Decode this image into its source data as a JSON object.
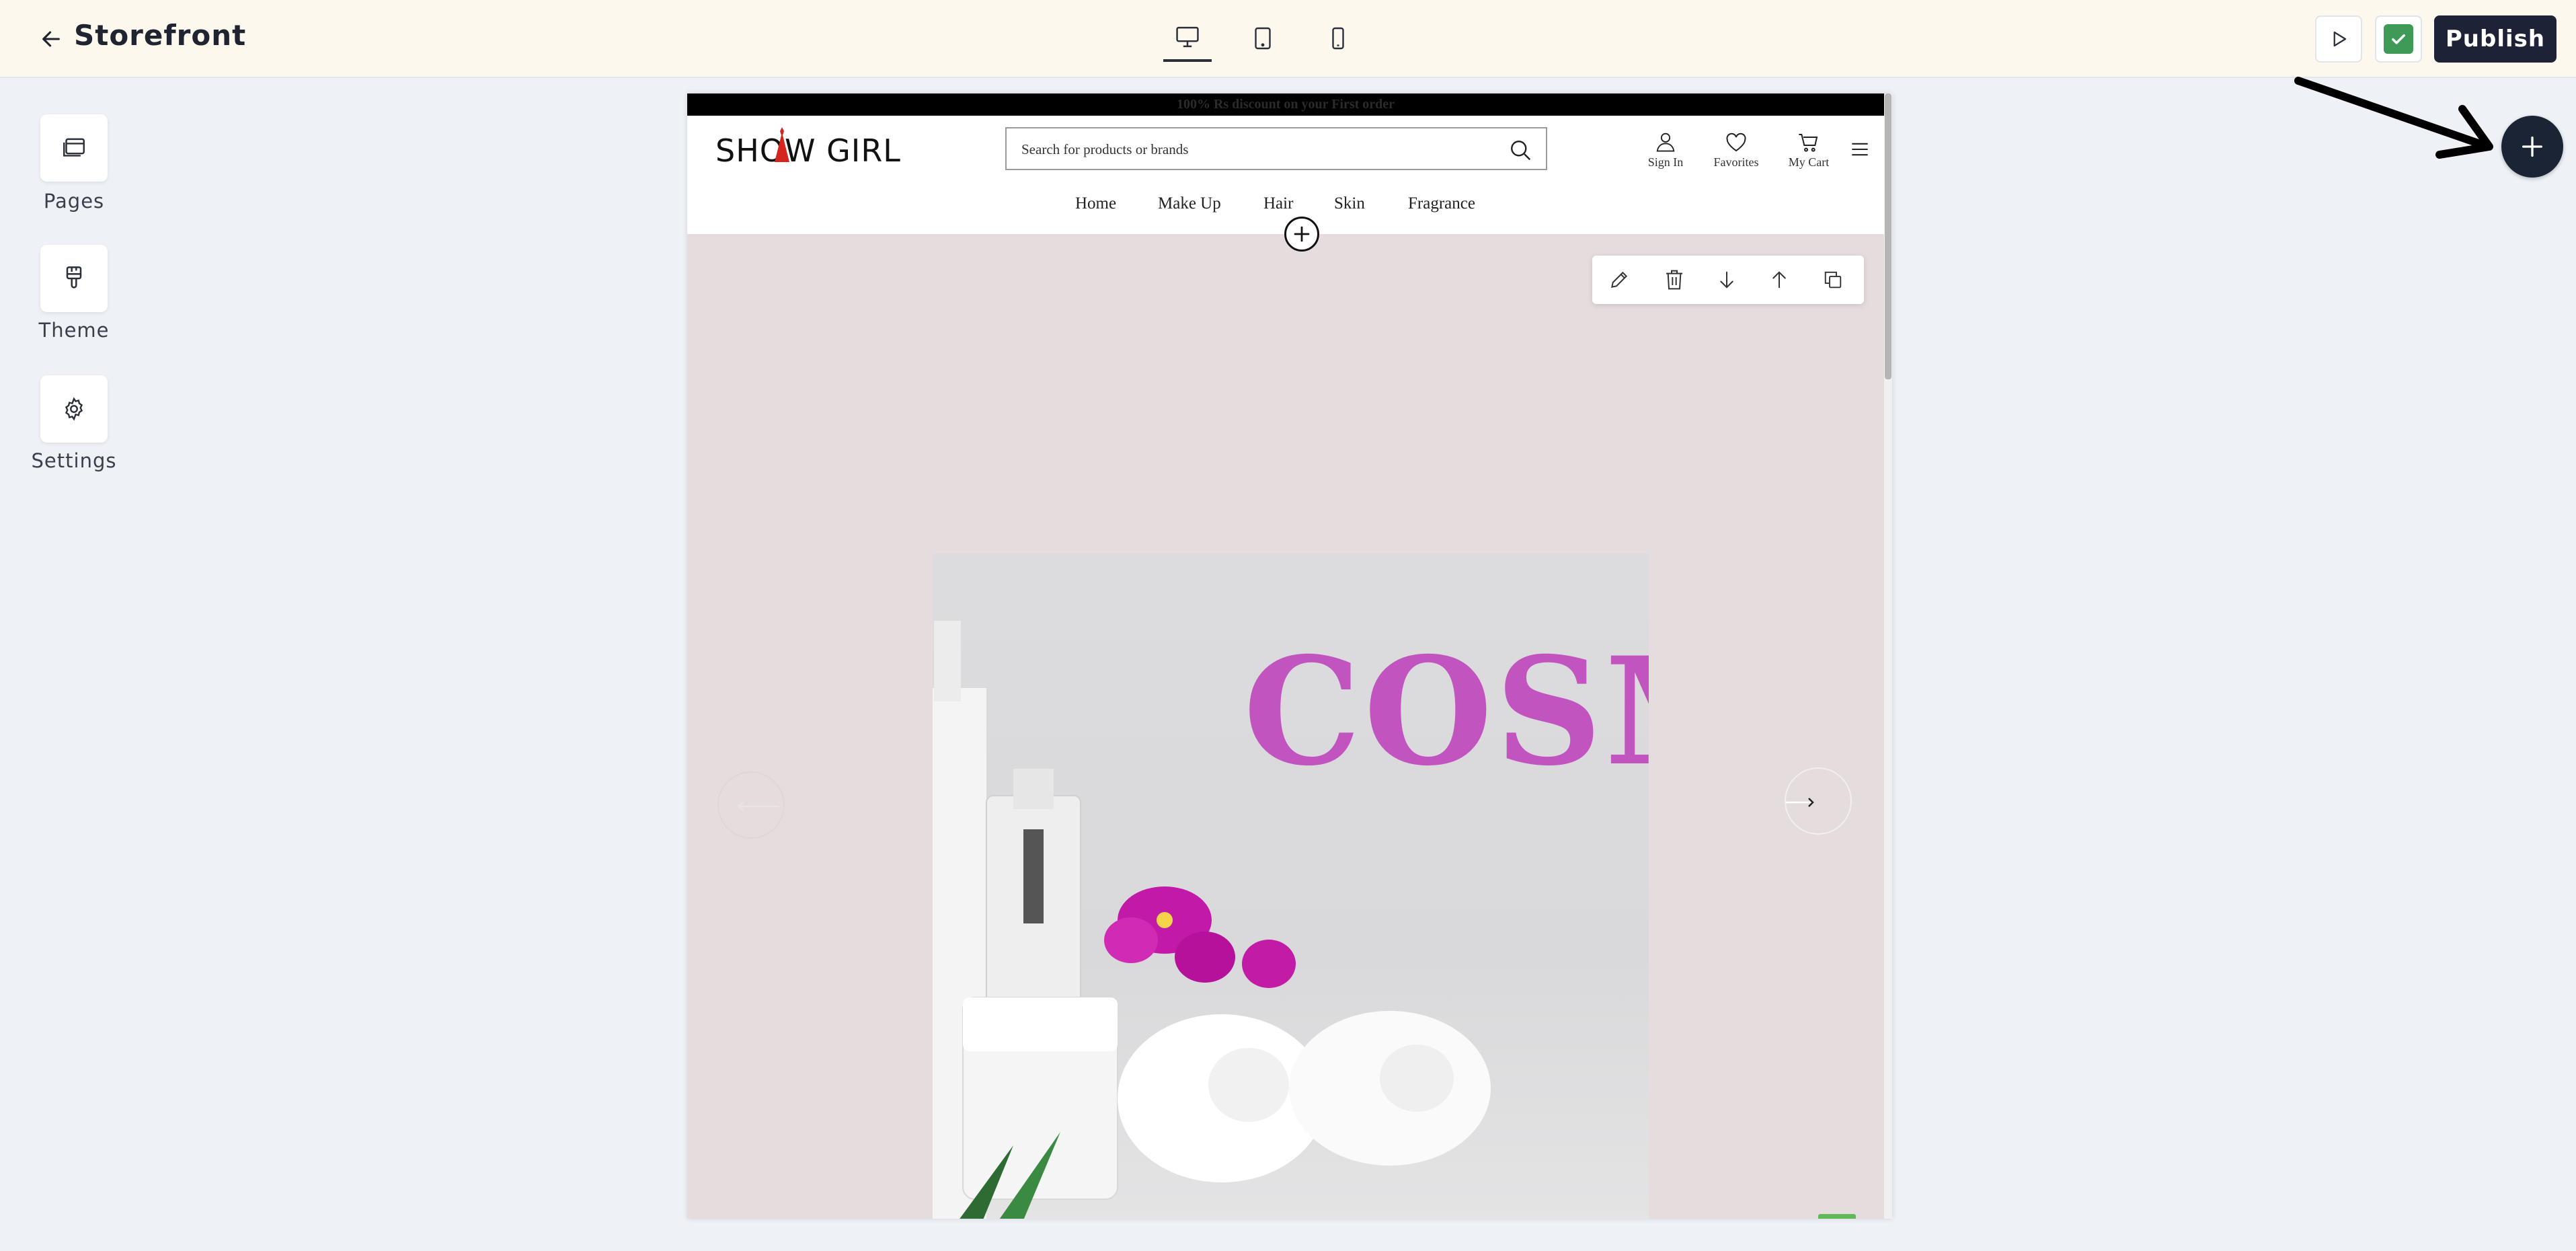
{
  "header": {
    "title": "Storefront",
    "publish_label": "Publish",
    "devices": [
      "desktop",
      "tablet",
      "mobile"
    ],
    "active_device": "desktop"
  },
  "sidebar": {
    "items": [
      {
        "label": "Pages",
        "icon": "pages-icon"
      },
      {
        "label": "Theme",
        "icon": "brush-icon"
      },
      {
        "label": "Settings",
        "icon": "gear-icon"
      }
    ]
  },
  "store": {
    "announcement": "100% Rs discount on your First order",
    "brand": "SHOW GIRL",
    "search_placeholder": "Search for products or brands",
    "actions": [
      {
        "label": "Sign In",
        "icon": "user-icon"
      },
      {
        "label": "Favorites",
        "icon": "heart-icon"
      },
      {
        "label": "My Cart",
        "icon": "cart-icon"
      }
    ],
    "nav": [
      "Home",
      "Make Up",
      "Hair",
      "Skin",
      "Fragrance"
    ],
    "hero_text": "COSM",
    "section_tools": [
      "edit-icon",
      "trash-icon",
      "move-down-icon",
      "move-up-icon",
      "duplicate-icon"
    ]
  },
  "colors": {
    "topbar_bg": "#fdf8ee",
    "publish_bg": "#1e2236",
    "save_green": "#3e9b57",
    "hero_bg": "#e5dcdd",
    "hero_text": "#c154bf",
    "whatsapp": "#5fb95a"
  }
}
